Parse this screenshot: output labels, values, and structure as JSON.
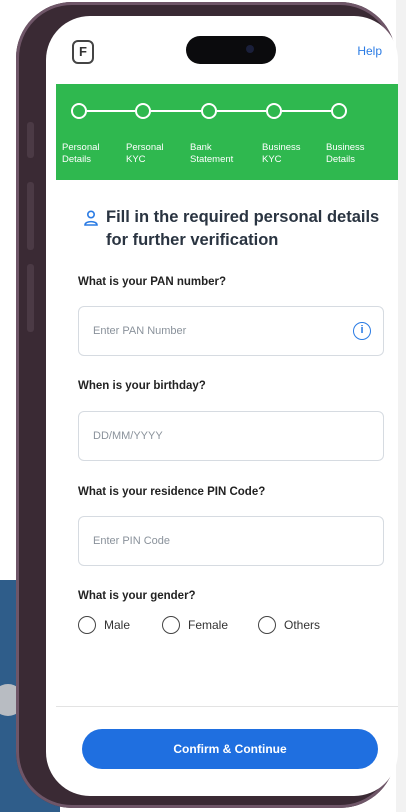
{
  "header": {
    "logo_char": "F",
    "help": "Help"
  },
  "stepper": {
    "steps": [
      {
        "label": "Personal\nDetails"
      },
      {
        "label": "Personal\nKYC"
      },
      {
        "label": "Bank\nStatement"
      },
      {
        "label": "Business\nKYC"
      },
      {
        "label": "Business\nDetails"
      }
    ]
  },
  "form": {
    "heading": "Fill in the required personal details for further verification",
    "heading_icon": "user-icon",
    "pan": {
      "question": "What is your PAN number?",
      "placeholder": "Enter PAN Number",
      "icon": "info-icon"
    },
    "birthday": {
      "question": "When is your birthday?",
      "placeholder": "DD/MM/YYYY"
    },
    "pin": {
      "question": "What is your residence PIN Code?",
      "placeholder": "Enter PIN Code"
    },
    "gender": {
      "question": "What is your gender?",
      "options": [
        "Male",
        "Female",
        "Others"
      ]
    }
  },
  "cta": {
    "label": "Confirm & Continue"
  },
  "colors": {
    "accent_green": "#2fb84f",
    "primary_blue": "#1f6fe0",
    "phone_frame": "#3a2a34"
  }
}
